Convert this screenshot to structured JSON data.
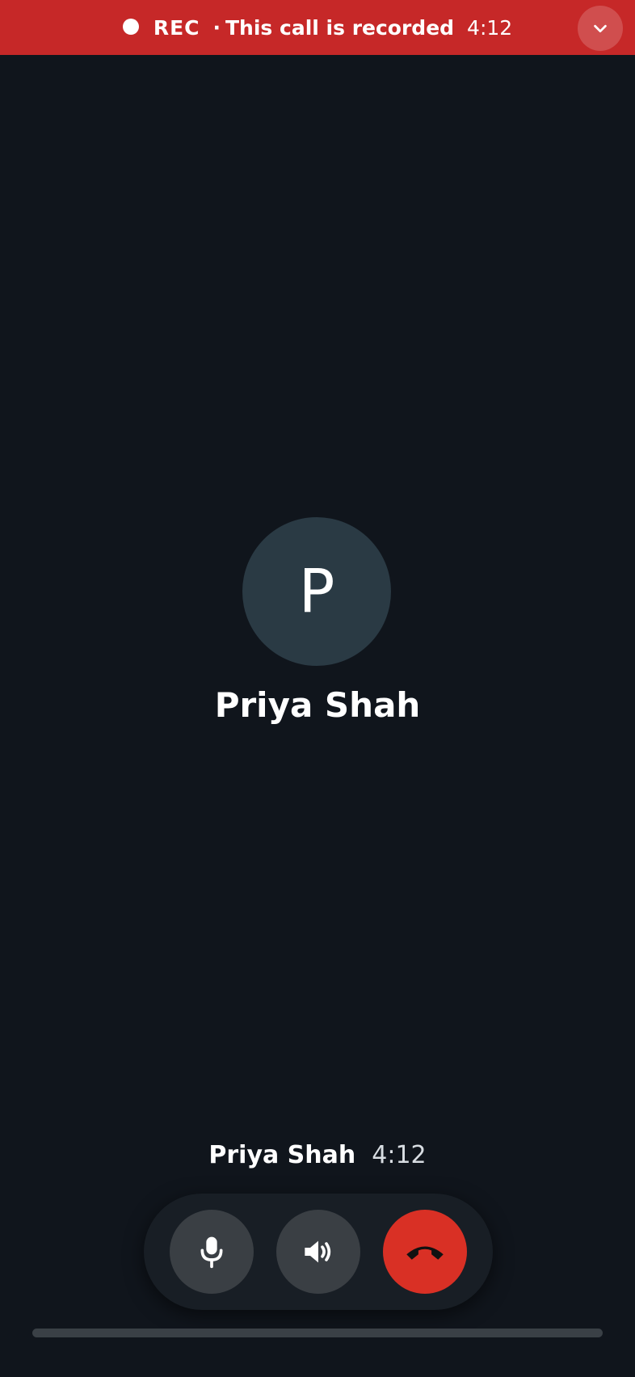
{
  "recording_bar": {
    "label": "REC",
    "separator": "·",
    "notice": "This call is recorded",
    "timer": "4:12",
    "collapse_icon": "chevron-down-icon",
    "color": "#c62828"
  },
  "caller": {
    "initial": "P",
    "name": "Priya Shah"
  },
  "mini_bar": {
    "name": "Priya Shah",
    "timer": "4:12"
  },
  "controls": {
    "mute_icon": "microphone-icon",
    "speaker_icon": "speaker-icon",
    "end_call_icon": "end-call-icon",
    "end_call_color": "#d93025"
  }
}
